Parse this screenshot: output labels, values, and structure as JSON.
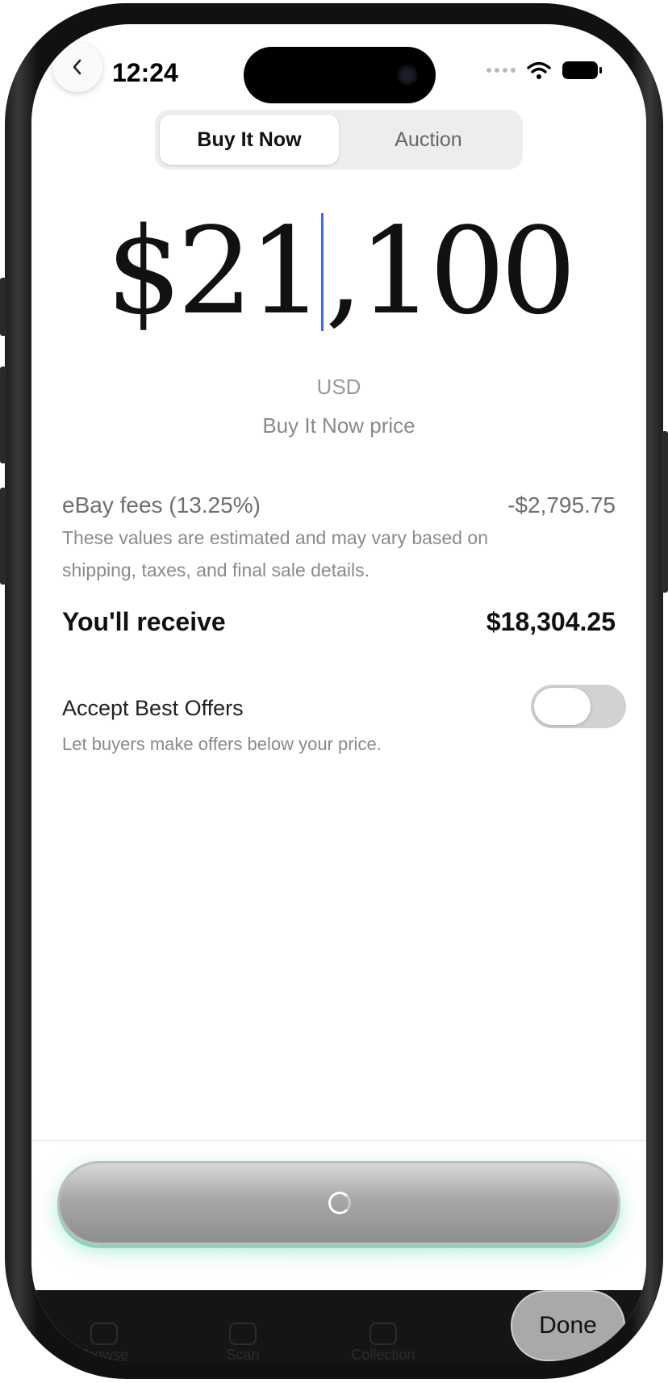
{
  "status_bar": {
    "time": "12:24"
  },
  "segment": {
    "options": [
      {
        "label": "Buy It Now",
        "selected": true
      },
      {
        "label": "Auction",
        "selected": false
      }
    ]
  },
  "price": {
    "before_cursor": "$21",
    "after_cursor": ",100",
    "currency": "USD",
    "caption": "Buy It Now price"
  },
  "fees": {
    "label": "eBay fees (13.25%)",
    "value": "-$2,795.75"
  },
  "note": "These values are estimated and may vary based on shipping, taxes, and final sale details.",
  "receive": {
    "label": "You'll receive",
    "value": "$18,304.25"
  },
  "best_offers": {
    "title": "Accept Best Offers",
    "subtitle": "Let buyers make offers below your price.",
    "enabled": false
  },
  "tabbar": {
    "items": [
      "Browse",
      "Scan",
      "Collection"
    ]
  },
  "done_label": "Done",
  "colors": {
    "cursor": "#3b6ef5",
    "cta_glow": "#7fd9bd",
    "toggle_off": "#d2d2d2"
  }
}
